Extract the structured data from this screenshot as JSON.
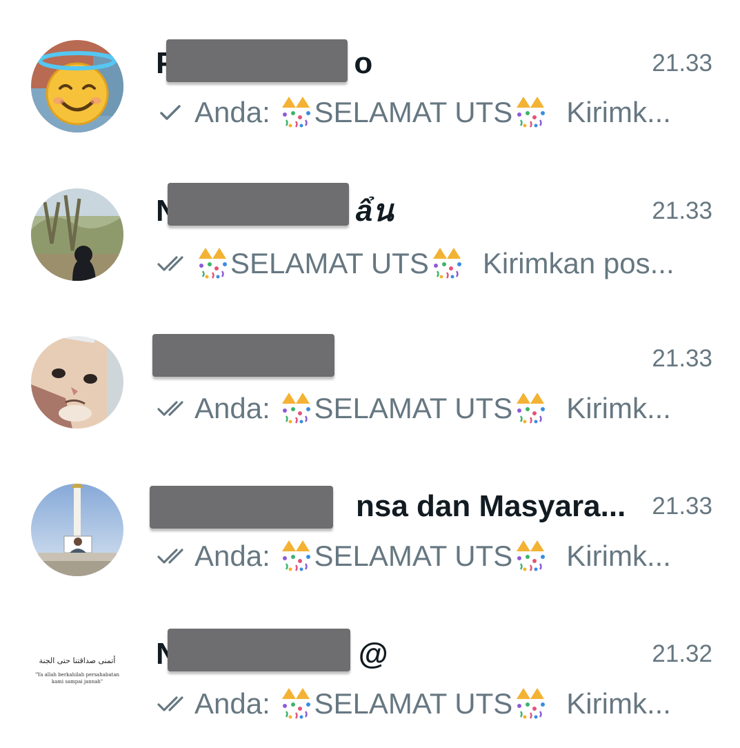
{
  "chats": [
    {
      "name_visible_start": "P",
      "name_visible_end": "o",
      "time": "21.33",
      "tick": "single-check",
      "sender": "Anda: ",
      "message": "SELAMAT UTS",
      "trail": "Kirimk..."
    },
    {
      "name_visible_start": "N",
      "name_visible_end": "ẩน",
      "time": "21.33",
      "tick": "double-check",
      "sender": "",
      "message": "SELAMAT UTS",
      "trail": "Kirimkan pos..."
    },
    {
      "name_visible_start": "",
      "name_visible_end": "",
      "time": "21.33",
      "tick": "double-check",
      "sender": "Anda: ",
      "message": "SELAMAT UTS",
      "trail": "Kirimk..."
    },
    {
      "name_visible_start": "",
      "name_visible_end": "nsa dan Masyara...",
      "time": "21.33",
      "tick": "double-check",
      "sender": "Anda: ",
      "message": "SELAMAT UTS",
      "trail": "Kirimk..."
    },
    {
      "name_visible_start": "N",
      "name_visible_end": "@",
      "time": "21.32",
      "tick": "double-check",
      "sender": "Anda: ",
      "message": "SELAMAT UTS",
      "trail": "Kirimk..."
    }
  ],
  "avatar5": {
    "arabic": "أتمنى صداقتنا حتى الجنة",
    "caption_line1": "\"Ya allah berkahilah persahabatan",
    "caption_line2": "kami sampai jannah\""
  },
  "colors": {
    "name": "#111b21",
    "meta": "#667781",
    "redaction": "#6e6e70"
  },
  "icons": [
    "check-icon",
    "double-check-icon",
    "confetti-popper-icon"
  ]
}
